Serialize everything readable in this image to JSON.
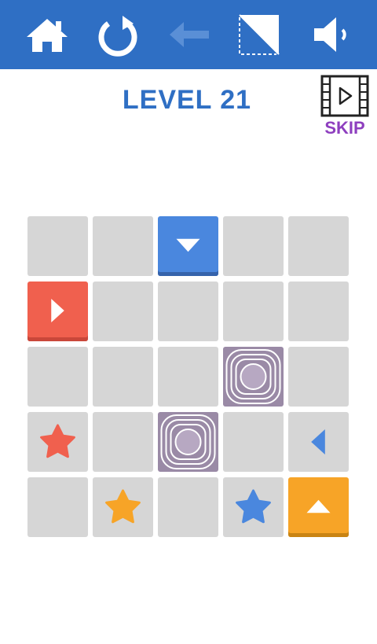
{
  "header": {
    "buttons": [
      {
        "name": "home-icon",
        "color": "#ffffff"
      },
      {
        "name": "restart-icon",
        "color": "#ffffff"
      },
      {
        "name": "undo-arrow-icon",
        "color": "#5a8fd6"
      },
      {
        "name": "hint-square-icon",
        "color": "#ffffff"
      },
      {
        "name": "sound-icon",
        "color": "#ffffff"
      }
    ],
    "background": "#2f6fc4"
  },
  "level": {
    "title": "LEVEL 21"
  },
  "skip": {
    "label": "SKIP",
    "icon": "video-play-icon",
    "color": "#8e3fbf"
  },
  "board": {
    "rows": 5,
    "cols": 5,
    "cell_color": "#d6d6d6",
    "pieces": [
      {
        "row": 0,
        "col": 2,
        "type": "block",
        "color": "blue",
        "direction": "down"
      },
      {
        "row": 1,
        "col": 0,
        "type": "block",
        "color": "red",
        "direction": "right"
      },
      {
        "row": 2,
        "col": 3,
        "type": "portal"
      },
      {
        "row": 3,
        "col": 0,
        "type": "star",
        "color": "red"
      },
      {
        "row": 3,
        "col": 2,
        "type": "portal"
      },
      {
        "row": 3,
        "col": 4,
        "type": "arrow",
        "color": "blue",
        "direction": "left"
      },
      {
        "row": 4,
        "col": 1,
        "type": "star",
        "color": "orange"
      },
      {
        "row": 4,
        "col": 3,
        "type": "star",
        "color": "blue"
      },
      {
        "row": 4,
        "col": 4,
        "type": "block",
        "color": "orange",
        "direction": "up"
      }
    ],
    "colors": {
      "red": "#f0604e",
      "blue": "#4a87de",
      "orange": "#f7a427",
      "portal": "#9a8aa6"
    }
  }
}
